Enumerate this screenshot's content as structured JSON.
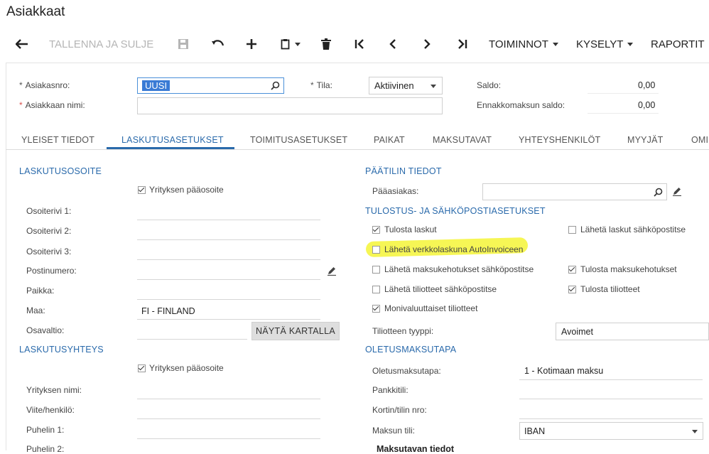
{
  "app": {
    "title": "Asiakkaat"
  },
  "toolbar": {
    "save_close": "TALLENNA JA SULJE",
    "actions": "TOIMINNOT",
    "inquiries": "KYSELYT",
    "reports": "RAPORTIT"
  },
  "header": {
    "customer_no_label": "Asiakasnro:",
    "customer_no_value": "UUSI",
    "customer_name_label": "Asiakkaan nimi:",
    "customer_name_value": "",
    "status_label": "Tila:",
    "status_value": "Aktiivinen",
    "balance_label": "Saldo:",
    "balance_value": "0,00",
    "prepay_label": "Ennakkomaksun saldo:",
    "prepay_value": "0,00"
  },
  "tabs": [
    {
      "label": "YLEISET TIEDOT"
    },
    {
      "label": "LASKUTUSASETUKSET",
      "active": true
    },
    {
      "label": "TOIMITUSASETUKSET"
    },
    {
      "label": "PAIKAT"
    },
    {
      "label": "MAKSUTAVAT"
    },
    {
      "label": "YHTEYSHENKILÖT"
    },
    {
      "label": "MYYJÄT"
    },
    {
      "label": "OMI"
    }
  ],
  "billing_address": {
    "section": "LASKUTUSOSOITE",
    "use_main": "Yrityksen pääosoite",
    "use_main_checked": true,
    "addr1": "Osoiterivi 1:",
    "addr2": "Osoiterivi 2:",
    "addr3": "Osoiterivi 3:",
    "postal": "Postinumero:",
    "city": "Paikka:",
    "country_label": "Maa:",
    "country_value": "FI - FINLAND",
    "state": "Osavaltio:",
    "map_button": "NÄYTÄ KARTALLA"
  },
  "billing_contact": {
    "section": "LASKUTUSYHTEYS",
    "use_main": "Yrityksen pääosoite",
    "use_main_checked": true,
    "company": "Yrityksen nimi:",
    "attention": "Viite/henkilö:",
    "phone1": "Puhelin 1:",
    "phone2": "Puhelin 2:"
  },
  "parent_account": {
    "section": "PÄÄTILIN TIEDOT",
    "parent_label": "Pääasiakas:"
  },
  "print_email": {
    "section": "TULOSTUS- JA SÄHKÖPOSTIASETUKSET",
    "print_invoices": "Tulosta laskut",
    "print_invoices_checked": true,
    "email_invoices": "Lähetä laskut sähköpostitse",
    "email_invoices_checked": false,
    "autoinvoice": "Lähetä verkkolaskuna AutoInvoiceen",
    "autoinvoice_checked": false,
    "email_dunning": "Lähetä maksukehotukset sähköpostitse",
    "email_dunning_checked": false,
    "print_dunning": "Tulosta maksukehotukset",
    "print_dunning_checked": true,
    "email_statements": "Lähetä tiliotteet sähköpostitse",
    "email_statements_checked": false,
    "print_statements": "Tulosta tiliotteet",
    "print_statements_checked": true,
    "multicurrency": "Monivaluuttaiset tiliotteet",
    "multicurrency_checked": true,
    "statement_type_label": "Tiliotteen tyyppi:",
    "statement_type_value": "Avoimet"
  },
  "default_payment": {
    "section": "OLETUSMAKSUTAPA",
    "method_label": "Oletusmaksutapa:",
    "method_value": "1 - Kotimaan maksu",
    "bank_label": "Pankkitili:",
    "card_label": "Kortin/tilin nro:",
    "pay_account_label": "Maksun tili:",
    "pay_account_value": "IBAN",
    "payer_info": "Maksutavan tiedot"
  }
}
